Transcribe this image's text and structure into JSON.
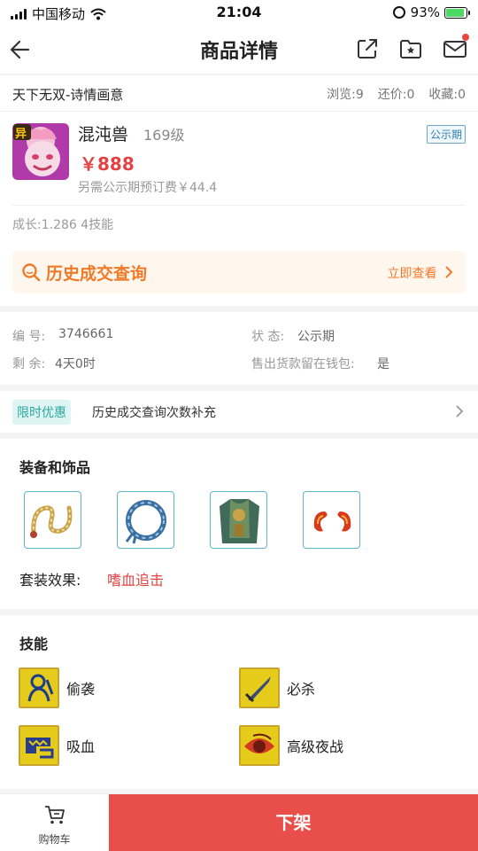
{
  "status_bar": {
    "carrier": "中国移动",
    "time": "21:04",
    "battery_percent": "93%",
    "battery_level": 0.93
  },
  "nav": {
    "title": "商品详情"
  },
  "product": {
    "title": "天下无双-诗情画意",
    "stats": {
      "views": "浏览:9",
      "offers": "还价:0",
      "favorites": "收藏:0"
    },
    "name": "混沌兽",
    "level": "169级",
    "phase_badge": "公示期",
    "avatar_badge": "异",
    "price": "￥888",
    "fee_note": "另需公示期预订费￥44.4",
    "growth": "成长:1.286 4技能"
  },
  "history": {
    "title": "历史成交查询",
    "link": "立即查看"
  },
  "info": {
    "id_label": "编 号:",
    "id_value": "3746661",
    "state_label": "状 态:",
    "state_value": "公示期",
    "remain_label": "剩 余:",
    "remain_value": "4天0时",
    "wallet_label": "售出货款留在钱包:",
    "wallet_value": "是"
  },
  "promo": {
    "tag": "限时优惠",
    "text": "历史成交查询次数补充"
  },
  "equipment": {
    "title": "装备和饰品",
    "set_label": "套装效果:",
    "set_value": "嗜血追击"
  },
  "skills": {
    "title": "技能",
    "items": [
      {
        "name": "偷袭"
      },
      {
        "name": "必杀"
      },
      {
        "name": "吸血"
      },
      {
        "name": "高级夜战"
      }
    ]
  },
  "bottom": {
    "cart_label": "购物车",
    "delist_label": "下架"
  },
  "colors": {
    "accent_red": "#e84e4a",
    "orange": "#f07a28",
    "teal": "#2aa8a0"
  }
}
